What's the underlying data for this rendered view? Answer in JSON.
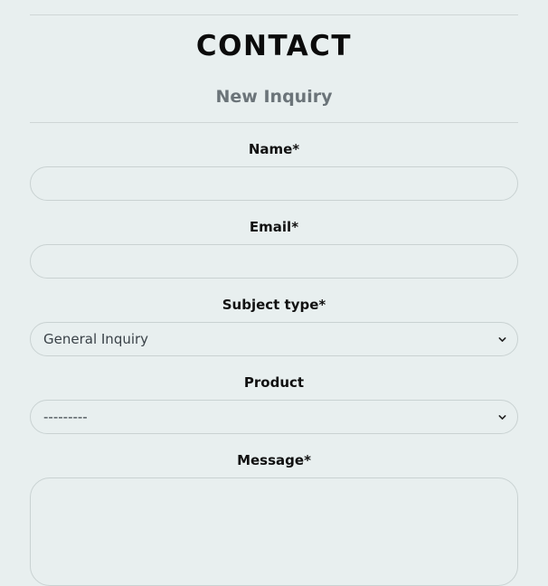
{
  "page": {
    "title": "CONTACT",
    "subtitle": "New Inquiry"
  },
  "form": {
    "name": {
      "label": "Name*",
      "value": ""
    },
    "email": {
      "label": "Email*",
      "value": ""
    },
    "subject_type": {
      "label": "Subject type*",
      "selected": "General Inquiry"
    },
    "product": {
      "label": "Product",
      "selected": "---------"
    },
    "message": {
      "label": "Message*",
      "value": ""
    }
  },
  "icons": {
    "select_chevron": "chevron-down-icon"
  }
}
